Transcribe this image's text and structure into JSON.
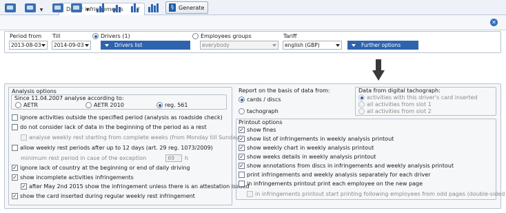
{
  "tab": {
    "title": "Driver infringements",
    "close": "✕"
  },
  "toolbar": {
    "generate_label": "Generate"
  },
  "period": {
    "from_label": "Period from",
    "from_value": "2013-08-03",
    "till_label": "Till",
    "till_value": "2014-09-03"
  },
  "drivers": {
    "radio_label": "Drivers (1)",
    "list_label": "Drivers list"
  },
  "employees": {
    "radio_label": "Employees groups",
    "value": "everybody"
  },
  "tariff": {
    "label": "Tariff",
    "value": "english (GBP)",
    "further": "Further options"
  },
  "analysis": {
    "title": "Analysis options",
    "since_label": "Since 11.04.2007 analyse according to:",
    "rules": [
      "AETR",
      "AETR 2010",
      "reg. 561"
    ],
    "options": [
      {
        "label": "ignore activities outside the specified period (analysis as roadside check)",
        "checked": false
      },
      {
        "label": "do not consider lack of data in the beginning of the period as a rest",
        "checked": false
      },
      {
        "label": "analyse weekly rest starting from complete weeks (from Monday till Sunday)",
        "checked": false,
        "disabled": true
      },
      {
        "label": "allow weekly rest periods after up to 12 days (art. 29 reg. 1073/2009)",
        "checked": false
      },
      {
        "label": "minimum rest period in case of the exception",
        "value": "69",
        "unit": "h",
        "disabled": true
      },
      {
        "label": "ignore lack of country at the beginning or end of daily driving",
        "checked": true
      },
      {
        "label": "show incomplete activities infringements",
        "checked": true
      },
      {
        "label": "after May 2nd 2015 show the infringement unless there is an attestation issued",
        "checked": true
      },
      {
        "label": "show the card inserted during regular weekly rest infringement",
        "checked": true
      }
    ]
  },
  "report_basis": {
    "title": "Report on the basis of data from:",
    "options": [
      "cards / discs",
      "tachograph"
    ]
  },
  "digital": {
    "title": "Data from digital tachograph:",
    "options": [
      "activities with this driver's card inserted",
      "all activities from slot 1",
      "all activities from slot 2"
    ]
  },
  "printout": {
    "title": "Printout options",
    "options": [
      {
        "label": "show fines",
        "checked": true
      },
      {
        "label": "show list of infringements in weekly analysis printout",
        "checked": true
      },
      {
        "label": "show weekly chart in weekly analysis printout",
        "checked": true
      },
      {
        "label": "show weeks details in weekly analysis printout",
        "checked": true
      },
      {
        "label": "show annotations from discs in infringements and weekly analysis printout",
        "checked": true
      },
      {
        "label": "print infringements and weekly analysis separately for each driver",
        "checked": false
      },
      {
        "label": "in infringements printout print each employee on the new page",
        "checked": false
      },
      {
        "label": "in infringements printout start printing following employees from odd pages (double-sided printout)",
        "checked": false,
        "disabled": true
      }
    ]
  }
}
